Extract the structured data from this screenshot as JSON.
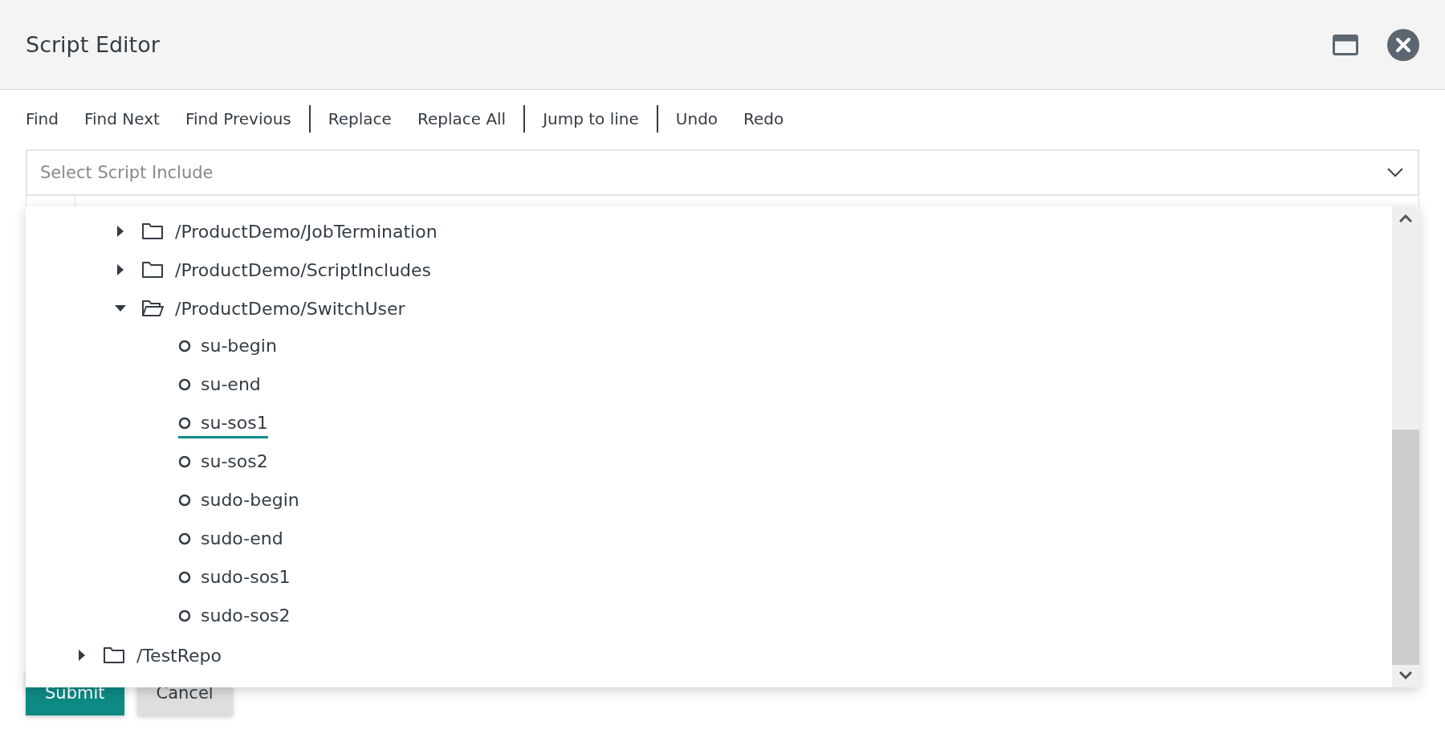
{
  "window": {
    "title": "Script Editor"
  },
  "toolbar": [
    {
      "label": "Find",
      "separator_after": false
    },
    {
      "label": "Find Next",
      "separator_after": false
    },
    {
      "label": "Find Previous",
      "separator_after": true
    },
    {
      "label": "Replace",
      "separator_after": false
    },
    {
      "label": "Replace All",
      "separator_after": true
    },
    {
      "label": "Jump to line",
      "separator_after": true
    },
    {
      "label": "Undo",
      "separator_after": false
    },
    {
      "label": "Redo",
      "separator_after": false
    }
  ],
  "select": {
    "placeholder": "Select Script Include"
  },
  "tree": [
    {
      "children": [
        {
          "label": "/ProductDemo/JobTermination",
          "kind": "folder",
          "expanded": false
        },
        {
          "label": "/ProductDemo/ScriptIncludes",
          "kind": "folder",
          "expanded": false
        },
        {
          "label": "/ProductDemo/SwitchUser",
          "kind": "folder",
          "expanded": true,
          "children": [
            {
              "label": "su-begin",
              "kind": "script",
              "selected": false
            },
            {
              "label": "su-end",
              "kind": "script",
              "selected": false
            },
            {
              "label": "su-sos1",
              "kind": "script",
              "selected": true
            },
            {
              "label": "su-sos2",
              "kind": "script",
              "selected": false
            },
            {
              "label": "sudo-begin",
              "kind": "script",
              "selected": false
            },
            {
              "label": "sudo-end",
              "kind": "script",
              "selected": false
            },
            {
              "label": "sudo-sos1",
              "kind": "script",
              "selected": false
            },
            {
              "label": "sudo-sos2",
              "kind": "script",
              "selected": false
            }
          ]
        }
      ]
    },
    {
      "label": "/TestRepo",
      "kind": "folder",
      "expanded": false
    }
  ],
  "buttons": [
    {
      "label": "Submit",
      "kind": "primary"
    },
    {
      "label": "Cancel",
      "kind": "secondary"
    }
  ]
}
